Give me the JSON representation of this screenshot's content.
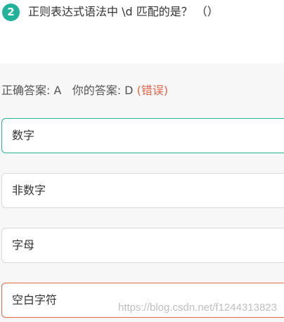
{
  "question": {
    "number": "2",
    "text": "正则表达式语法中 \\d 匹配的是？ （）"
  },
  "answer": {
    "correct_label": "正确答案: A",
    "yours_label": "你的答案: D",
    "status": "(错误)"
  },
  "options": [
    {
      "text": "数字"
    },
    {
      "text": "非数字"
    },
    {
      "text": "字母"
    },
    {
      "text": "空白字符"
    }
  ],
  "watermark": "https://blog.csdn.net/f1244313823",
  "colors": {
    "accent": "#1fb39b",
    "correct_border": "#27b598",
    "wrong": "#e8664a",
    "panel_bg": "#f7f7f7"
  }
}
